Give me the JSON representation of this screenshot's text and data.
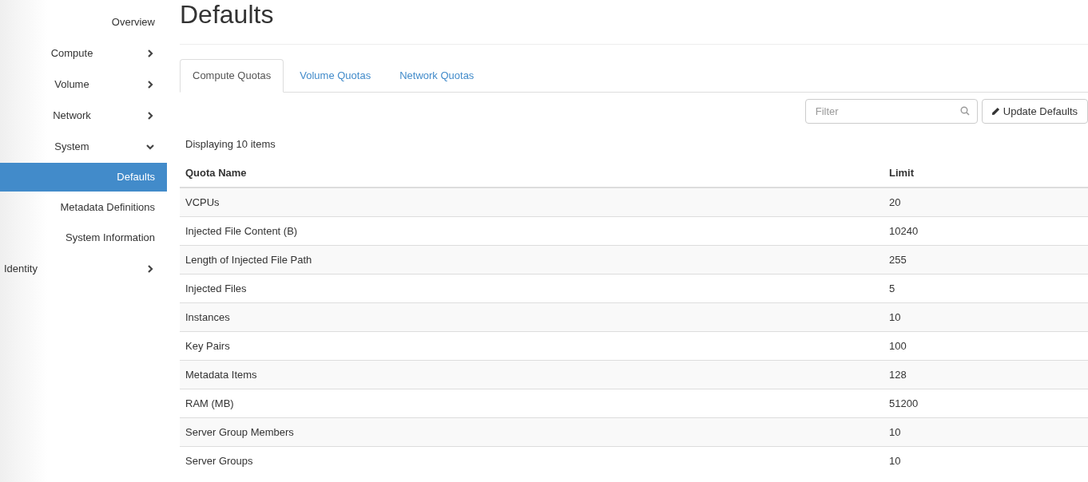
{
  "sidebar": {
    "items": [
      {
        "kind": "link",
        "label": "Overview",
        "selected": false
      },
      {
        "kind": "group",
        "label": "Compute",
        "expanded": false
      },
      {
        "kind": "group",
        "label": "Volume",
        "expanded": false
      },
      {
        "kind": "group",
        "label": "Network",
        "expanded": false
      },
      {
        "kind": "group",
        "label": "System",
        "expanded": true,
        "children": [
          {
            "label": "Defaults",
            "selected": true
          },
          {
            "label": "Metadata Definitions",
            "selected": false
          },
          {
            "label": "System Information",
            "selected": false
          }
        ]
      },
      {
        "kind": "panel",
        "label": "Identity",
        "expanded": false
      }
    ]
  },
  "page_title": "Defaults",
  "tabs": [
    {
      "label": "Compute Quotas",
      "selected": true
    },
    {
      "label": "Volume Quotas",
      "selected": false
    },
    {
      "label": "Network Quotas",
      "selected": false
    }
  ],
  "filter": {
    "placeholder": "Filter"
  },
  "update_button": "Update Defaults",
  "item_count": "Displaying 10 items",
  "table": {
    "columns": [
      "Quota Name",
      "Limit"
    ],
    "rows": [
      [
        "VCPUs",
        "20"
      ],
      [
        "Injected File Content (B)",
        "10240"
      ],
      [
        "Length of Injected File Path",
        "255"
      ],
      [
        "Injected Files",
        "5"
      ],
      [
        "Instances",
        "10"
      ],
      [
        "Key Pairs",
        "100"
      ],
      [
        "Metadata Items",
        "128"
      ],
      [
        "RAM (MB)",
        "51200"
      ],
      [
        "Server Group Members",
        "10"
      ],
      [
        "Server Groups",
        "10"
      ]
    ]
  }
}
